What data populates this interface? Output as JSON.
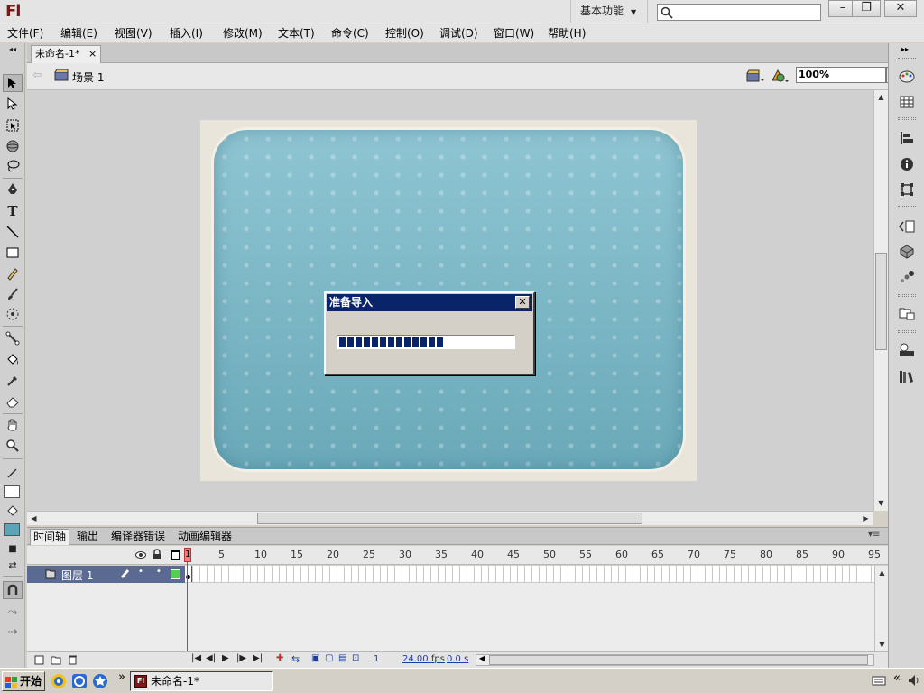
{
  "app": {
    "logo": "Fl",
    "workspace_label": "基本功能",
    "search_placeholder": ""
  },
  "window_controls": {
    "minimize": "–",
    "restore": "❐",
    "close": "✕"
  },
  "menu": [
    {
      "label": "文件(F)",
      "id": "file"
    },
    {
      "label": "编辑(E)",
      "id": "edit"
    },
    {
      "label": "视图(V)",
      "id": "view"
    },
    {
      "label": "插入(I)",
      "id": "insert"
    },
    {
      "label": "修改(M)",
      "id": "modify"
    },
    {
      "label": "文本(T)",
      "id": "text"
    },
    {
      "label": "命令(C)",
      "id": "commands"
    },
    {
      "label": "控制(O)",
      "id": "control"
    },
    {
      "label": "调试(D)",
      "id": "debug"
    },
    {
      "label": "窗口(W)",
      "id": "window"
    },
    {
      "label": "帮助(H)",
      "id": "help"
    }
  ],
  "document": {
    "tab_label": "未命名-1*",
    "tab_close": "×",
    "scene_label": "场景 1",
    "zoom": "100%"
  },
  "dialog": {
    "title": "准备导入",
    "close": "✕",
    "progress": 0.6
  },
  "timeline": {
    "tabs": [
      "时间轴",
      "输出",
      "编译器错误",
      "动画编辑器"
    ],
    "active_tab": 0,
    "layer_name": "图层 1",
    "frame_numbers": [
      "1",
      "5",
      "10",
      "15",
      "20",
      "25",
      "30",
      "35",
      "40",
      "45",
      "50",
      "55",
      "60",
      "65",
      "70",
      "75",
      "80",
      "85",
      "90",
      "95"
    ],
    "current_frame": "1",
    "fps": "24.00",
    "fps_unit": "fps",
    "elapsed": "0.0",
    "elapsed_unit": "s"
  },
  "taskbar": {
    "start_label": "开始",
    "window_label": "未命名-1*",
    "chevron": "»",
    "tray_chevron": "«"
  },
  "colors": {
    "layer_highlight": "#5a6a92",
    "dialog_titlebar": "#0a246a",
    "progress_fill": "#0a246a",
    "stage_card": "#7ab7c5",
    "playhead": "#e03030",
    "logo": "#7a1818"
  }
}
